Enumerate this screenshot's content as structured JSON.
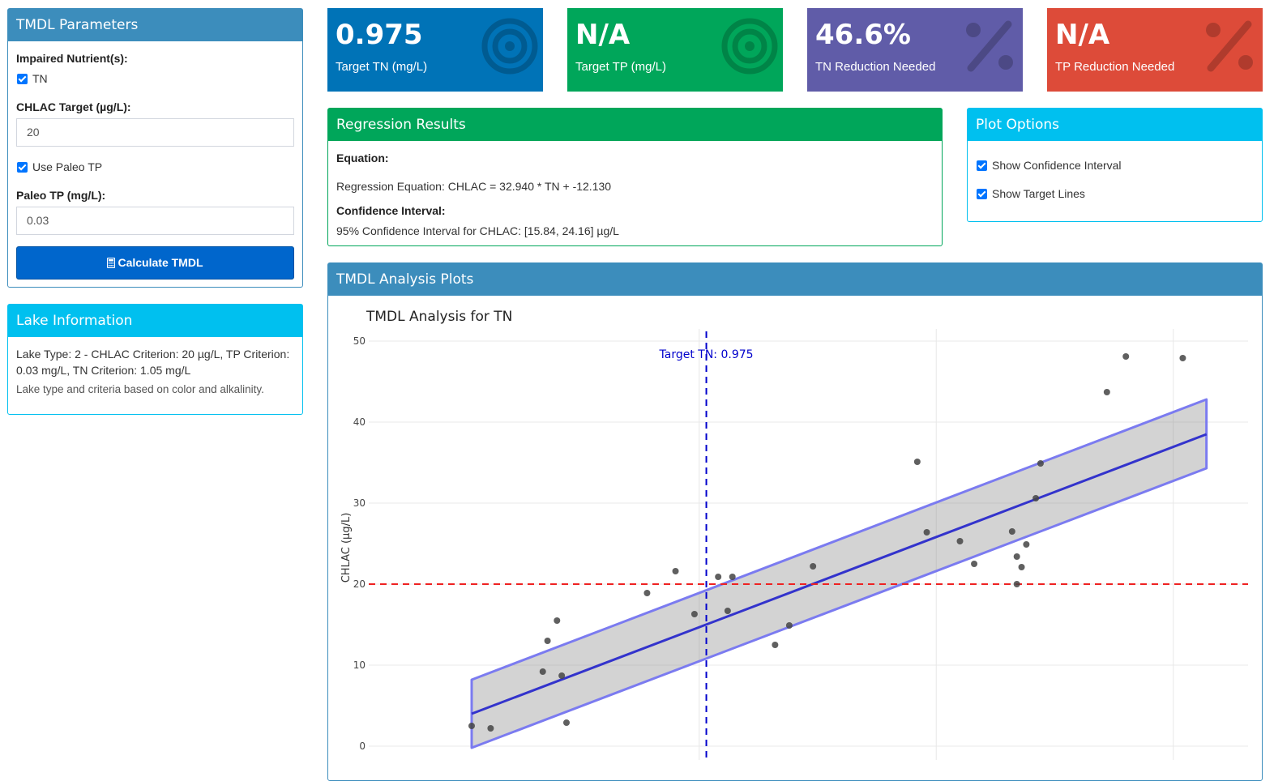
{
  "sidebar": {
    "params_title": "TMDL Parameters",
    "impaired_label": "Impaired Nutrient(s):",
    "tn_label": "TN",
    "chlac_label": "CHLAC Target (µg/L):",
    "chlac_value": "20",
    "paleo_check_label": "Use Paleo TP",
    "paleo_label": "Paleo TP (mg/L):",
    "paleo_value": "0.03",
    "calc_button": "Calculate TMDL",
    "lake_title": "Lake Information",
    "lake_info": "Lake Type: 2 - CHLAC Criterion: 20 µg/L, TP Criterion: 0.03 mg/L, TN Criterion: 1.05 mg/L",
    "lake_note": "Lake type and criteria based on color and alkalinity."
  },
  "value_boxes": [
    {
      "value": "0.975",
      "label": "Target TN (mg/L)",
      "color": "#0073b7",
      "icon": "bullseye-icon"
    },
    {
      "value": "N/A",
      "label": "Target TP (mg/L)",
      "color": "#00a65a",
      "icon": "bullseye-icon"
    },
    {
      "value": "46.6%",
      "label": "TN Reduction Needed",
      "color": "#605ca8",
      "icon": "percent-icon"
    },
    {
      "value": "N/A",
      "label": "TP Reduction Needed",
      "color": "#dd4b39",
      "icon": "percent-icon"
    }
  ],
  "regression": {
    "title": "Regression Results",
    "equation_label": "Equation:",
    "equation_text": "Regression Equation: CHLAC = 32.940 * TN + -12.130",
    "ci_label": "Confidence Interval:",
    "ci_text": "95% Confidence Interval for CHLAC: [15.84, 24.16] µg/L"
  },
  "plot_options": {
    "title": "Plot Options",
    "show_ci": "Show Confidence Interval",
    "show_targets": "Show Target Lines"
  },
  "plots": {
    "box_title": "TMDL Analysis Plots"
  },
  "chart_data": {
    "type": "scatter",
    "title": "TMDL Analysis for TN",
    "ylabel": "CHLAC (µg/L)",
    "xlabel": "",
    "ylim": [
      -3,
      51
    ],
    "xlim": [
      0.48,
      2.34
    ],
    "yticks": [
      0,
      10,
      20,
      30,
      40,
      50
    ],
    "xgrid": [
      0.96,
      1.46,
      1.96
    ],
    "grid": true,
    "target_x": 0.975,
    "target_y": 20,
    "target_label": "Target TN: 0.975",
    "fit": {
      "x": [
        0.48,
        2.03
      ],
      "y": [
        4.0,
        38.5
      ]
    },
    "ci_band": {
      "x": [
        0.48,
        2.03
      ],
      "upper": [
        8.2,
        42.8
      ],
      "lower": [
        -0.2,
        34.3
      ]
    },
    "points": {
      "x": [
        0.48,
        0.52,
        0.63,
        0.64,
        0.66,
        0.67,
        0.68,
        0.85,
        0.91,
        0.95,
        1.0,
        1.02,
        1.03,
        1.12,
        1.15,
        1.2,
        1.42,
        1.44,
        1.51,
        1.54,
        1.62,
        1.63,
        1.63,
        1.64,
        1.65,
        1.67,
        1.68,
        1.82,
        1.86,
        1.98
      ],
      "y": [
        2.5,
        2.2,
        9.2,
        13.0,
        15.5,
        8.7,
        2.9,
        18.9,
        21.6,
        16.3,
        20.9,
        16.7,
        20.9,
        12.5,
        14.9,
        22.2,
        35.1,
        26.4,
        25.3,
        22.5,
        26.5,
        20.0,
        23.4,
        22.1,
        24.9,
        30.6,
        34.9,
        43.7,
        48.1,
        47.9
      ]
    }
  }
}
